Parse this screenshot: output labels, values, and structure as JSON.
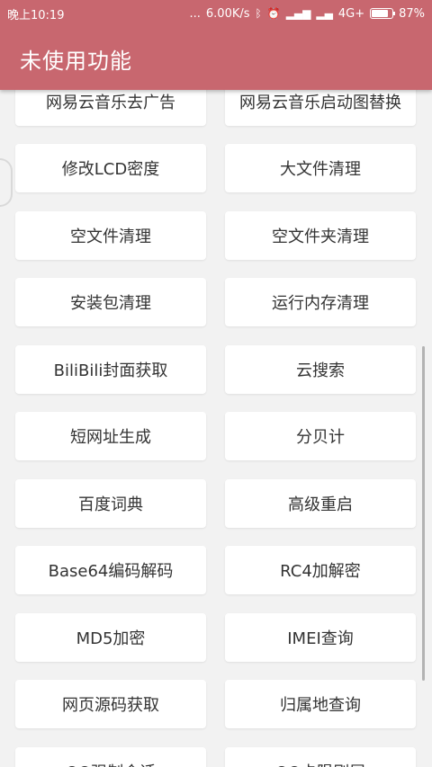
{
  "status": {
    "time": "晚上10:19",
    "net_speed": "6.00K/s",
    "dots": "...",
    "network": "4G+",
    "battery": "87%"
  },
  "appbar": {
    "title": "未使用功能"
  },
  "buttons": [
    "网易云音乐去广告",
    "网易云音乐启动图替换",
    "修改LCD密度",
    "大文件清理",
    "空文件清理",
    "空文件夹清理",
    "安装包清理",
    "运行内存清理",
    "BiliBili封面获取",
    "云搜索",
    "短网址生成",
    "分贝计",
    "百度词典",
    "高级重启",
    "Base64编码解码",
    "RC4加解密",
    "MD5加密",
    "IMEI查询",
    "网页源码获取",
    "归属地查询",
    "QQ强制会话",
    "QQ卡陨刷屏"
  ]
}
